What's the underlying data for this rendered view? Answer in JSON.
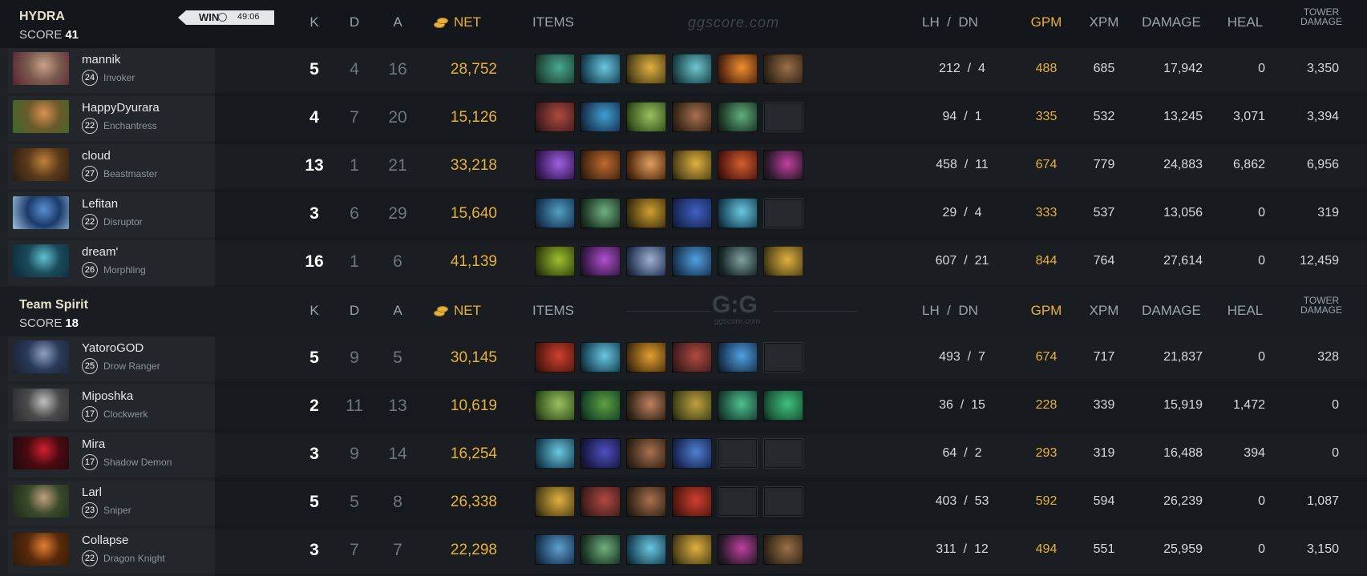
{
  "columns": {
    "k": "K",
    "d": "D",
    "a": "A",
    "net": "NET",
    "items": "ITEMS",
    "lh_dn": "LH  /  DN",
    "gpm": "GPM",
    "xpm": "XPM",
    "damage": "DAMAGE",
    "heal": "HEAL",
    "tower_damage_1": "TOWER",
    "tower_damage_2": "DAMAGE"
  },
  "watermark": {
    "text": "ggscore.com",
    "logo": "G:G",
    "sub": "ggscore.com"
  },
  "match": {
    "result": "WIN",
    "duration": "49:06"
  },
  "teams": [
    {
      "name": "HYDRA",
      "score_label": "SCORE",
      "score": "41",
      "players": [
        {
          "name": "mannik",
          "level": "24",
          "hero": "Invoker",
          "k": "5",
          "d": "4",
          "a": "16",
          "net": "28,752",
          "lh": "212",
          "dn": "4",
          "gpm": "488",
          "xpm": "685",
          "damage": "17,942",
          "heal": "0",
          "tower": "3,350",
          "portrait": [
            "#7a5a4e",
            "#c9a087",
            "#5a2030"
          ],
          "items": [
            [
              "#1f4a3a",
              "#4aa890"
            ],
            [
              "#1b4a5e",
              "#6ac8e0"
            ],
            [
              "#5a4a1a",
              "#e0b040"
            ],
            [
              "#1e4a50",
              "#70c8d0"
            ],
            [
              "#5a2a10",
              "#f09030"
            ],
            [
              "#3a2a1a",
              "#9a7048"
            ]
          ]
        },
        {
          "name": "HappyDyurara",
          "level": "22",
          "hero": "Enchantress",
          "k": "4",
          "d": "7",
          "a": "20",
          "net": "15,126",
          "lh": "94",
          "dn": "1",
          "gpm": "335",
          "xpm": "532",
          "damage": "13,245",
          "heal": "3,071",
          "tower": "3,394",
          "portrait": [
            "#6a5a2a",
            "#d89050",
            "#3a6a2a"
          ],
          "items": [
            [
              "#4a2020",
              "#b04a40"
            ],
            [
              "#1a3a5a",
              "#40a0d0"
            ],
            [
              "#3a5a20",
              "#9ac060"
            ],
            [
              "#3a2818",
              "#a87050"
            ],
            [
              "#1e3a28",
              "#60b080"
            ],
            null
          ]
        },
        {
          "name": "cloud",
          "level": "27",
          "hero": "Beastmaster",
          "k": "13",
          "d": "1",
          "a": "21",
          "net": "33,218",
          "lh": "458",
          "dn": "11",
          "gpm": "674",
          "xpm": "779",
          "damage": "24,883",
          "heal": "6,862",
          "tower": "6,956",
          "portrait": [
            "#5a3a1a",
            "#c0803a",
            "#2a1a10"
          ],
          "items": [
            [
              "#3a1a5a",
              "#a060e0"
            ],
            [
              "#4a2a10",
              "#c06a30"
            ],
            [
              "#5a3010",
              "#e0a060"
            ],
            [
              "#5a4a1a",
              "#e0b040"
            ],
            [
              "#5a1a10",
              "#d06030"
            ],
            [
              "#2a1a2a",
              "#c040a0"
            ]
          ]
        },
        {
          "name": "Lefitan",
          "level": "22",
          "hero": "Disruptor",
          "k": "3",
          "d": "6",
          "a": "29",
          "net": "15,640",
          "lh": "29",
          "dn": "4",
          "gpm": "333",
          "xpm": "537",
          "damage": "13,056",
          "heal": "0",
          "tower": "319",
          "portrait": [
            "#1a3a6a",
            "#5a90d0",
            "#a0c0e0"
          ],
          "items": [
            [
              "#1a3a5a",
              "#50a0c0"
            ],
            [
              "#1e3a28",
              "#70b080"
            ],
            [
              "#4a3a10",
              "#d0a030"
            ],
            [
              "#1a2a5a",
              "#4060c0"
            ],
            [
              "#1b4a5e",
              "#6ac8e0"
            ],
            null
          ]
        },
        {
          "name": "dream'",
          "level": "26",
          "hero": "Morphling",
          "k": "16",
          "d": "1",
          "a": "6",
          "net": "41,139",
          "lh": "607",
          "dn": "21",
          "gpm": "844",
          "xpm": "764",
          "damage": "27,614",
          "heal": "0",
          "tower": "12,459",
          "portrait": [
            "#1a4a5a",
            "#60c0d0",
            "#0a2a3a"
          ],
          "items": [
            [
              "#3a4a10",
              "#a0c030"
            ],
            [
              "#3a1a4a",
              "#b050d0"
            ],
            [
              "#2a3a5a",
              "#a0b0d0"
            ],
            [
              "#1a3a5a",
              "#50a0e0"
            ],
            [
              "#1a2a2a",
              "#80a0a0"
            ],
            [
              "#5a4a1a",
              "#e0b040"
            ]
          ]
        }
      ]
    },
    {
      "name": "Team Spirit",
      "score_label": "SCORE",
      "score": "18",
      "players": [
        {
          "name": "YatoroGOD",
          "level": "25",
          "hero": "Drow Ranger",
          "k": "5",
          "d": "9",
          "a": "5",
          "net": "30,145",
          "lh": "493",
          "dn": "7",
          "gpm": "674",
          "xpm": "717",
          "damage": "21,837",
          "heal": "0",
          "tower": "328",
          "portrait": [
            "#2a3a5a",
            "#90a0c0",
            "#1a2030"
          ],
          "items": [
            [
              "#5a1a10",
              "#d04030"
            ],
            [
              "#1b4a5e",
              "#6ac8e0"
            ],
            [
              "#5a3a10",
              "#e0a030"
            ],
            [
              "#4a2020",
              "#b04a40"
            ],
            [
              "#1a3a5a",
              "#50a0e0"
            ],
            null
          ]
        },
        {
          "name": "Miposhka",
          "level": "17",
          "hero": "Clockwerk",
          "k": "2",
          "d": "11",
          "a": "13",
          "net": "10,619",
          "lh": "36",
          "dn": "15",
          "gpm": "228",
          "xpm": "339",
          "damage": "15,919",
          "heal": "1,472",
          "tower": "0",
          "portrait": [
            "#4a4a4a",
            "#c0c0c0",
            "#2a2a30"
          ],
          "items": [
            [
              "#3a5a20",
              "#9ac060"
            ],
            [
              "#1a4a2a",
              "#60a040"
            ],
            [
              "#3a2a1a",
              "#c08060"
            ],
            [
              "#4a4a1a",
              "#c0a040"
            ],
            [
              "#1a4a3a",
              "#50c090"
            ],
            [
              "#1a5a3a",
              "#40c080"
            ]
          ]
        },
        {
          "name": "Mira",
          "level": "17",
          "hero": "Shadow Demon",
          "k": "3",
          "d": "9",
          "a": "14",
          "net": "16,254",
          "lh": "64",
          "dn": "2",
          "gpm": "293",
          "xpm": "319",
          "damage": "16,488",
          "heal": "394",
          "tower": "0",
          "portrait": [
            "#4a0a10",
            "#d02030",
            "#1a0a10"
          ],
          "items": [
            [
              "#1b4a5e",
              "#6ac8e0"
            ],
            [
              "#1a1a4a",
              "#5050c0"
            ],
            [
              "#3a2818",
              "#a87050"
            ],
            [
              "#1a2a5a",
              "#5080d0"
            ],
            null,
            null
          ]
        },
        {
          "name": "Larl",
          "level": "23",
          "hero": "Sniper",
          "k": "5",
          "d": "5",
          "a": "8",
          "net": "26,338",
          "lh": "403",
          "dn": "53",
          "gpm": "592",
          "xpm": "594",
          "damage": "26,239",
          "heal": "0",
          "tower": "1,087",
          "portrait": [
            "#3a4a2a",
            "#c0a080",
            "#1a2a1a"
          ],
          "items": [
            [
              "#5a4a1a",
              "#e0b040"
            ],
            [
              "#4a2020",
              "#b04a40"
            ],
            [
              "#3a2818",
              "#a87050"
            ],
            [
              "#5a1a10",
              "#d04030"
            ],
            null,
            null
          ]
        },
        {
          "name": "Collapse",
          "level": "22",
          "hero": "Dragon Knight",
          "k": "3",
          "d": "7",
          "a": "7",
          "net": "22,298",
          "lh": "311",
          "dn": "12",
          "gpm": "494",
          "xpm": "551",
          "damage": "25,959",
          "heal": "0",
          "tower": "3,150",
          "portrait": [
            "#5a2a0a",
            "#e08030",
            "#2a1a0a"
          ],
          "items": [
            [
              "#1a3a5a",
              "#60a0d0"
            ],
            [
              "#1e3a28",
              "#70b080"
            ],
            [
              "#1b4a5e",
              "#6ac8e0"
            ],
            [
              "#5a4a1a",
              "#e0b040"
            ],
            [
              "#2a1a2a",
              "#c040a0"
            ],
            [
              "#3a2a1a",
              "#9a7048"
            ]
          ]
        }
      ]
    }
  ]
}
